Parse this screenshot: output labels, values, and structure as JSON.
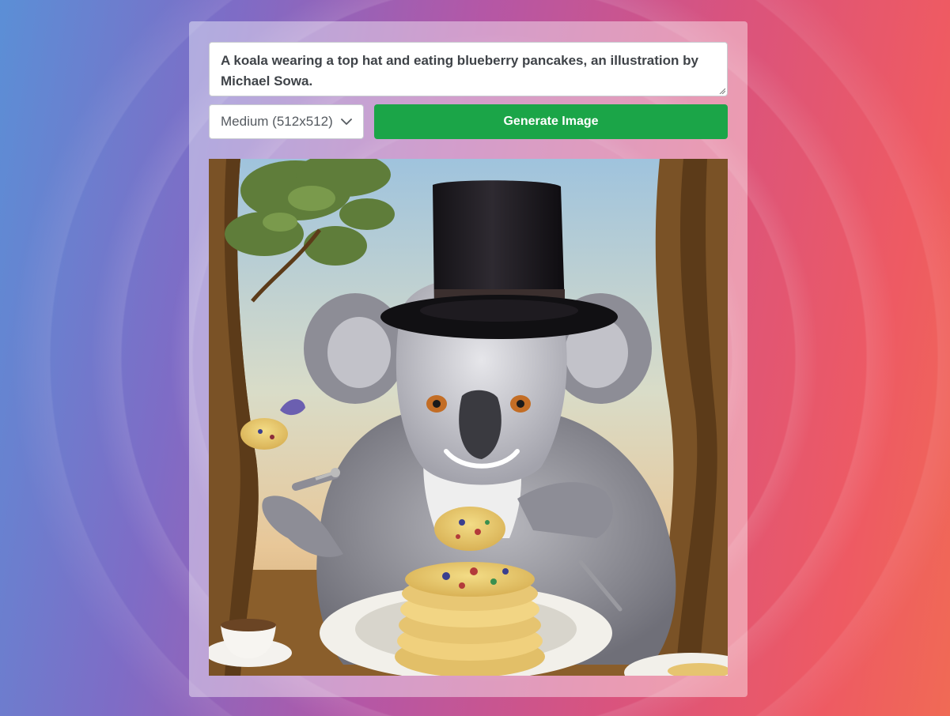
{
  "prompt": {
    "value": "A koala wearing a top hat and eating blueberry pancakes, an illustration by Michael Sowa."
  },
  "size_select": {
    "selected": "Medium (512x512)",
    "icon": "chevron-down-icon"
  },
  "generate_button": {
    "label": "Generate Image",
    "color": "#1ba548"
  },
  "result_image": {
    "subject": "generated-koala-illustration"
  },
  "colors": {
    "card_background": "rgba(255,255,255,0.42)",
    "text": "#3f4348"
  }
}
